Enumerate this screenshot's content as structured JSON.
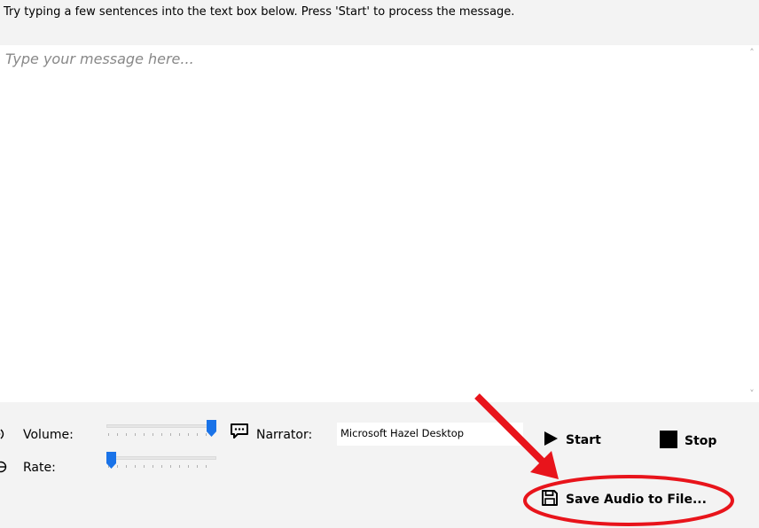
{
  "instruction": "Try typing a few sentences into the text box below. Press 'Start' to process the message.",
  "message_box": {
    "placeholder": "Type your message here...",
    "value": ""
  },
  "controls": {
    "volume_label": "Volume:",
    "volume_level": 1.0,
    "rate_label": "Rate:",
    "rate_level": 0.0,
    "narrator_label": "Narrator:",
    "narrator_value": "Microsoft Hazel Desktop"
  },
  "buttons": {
    "start_label": "Start",
    "stop_label": "Stop",
    "save_label": "Save Audio to File..."
  },
  "icons": {
    "volume": "speaker-icon",
    "rate": "speedometer-icon",
    "narrator": "speech-bubble-icon",
    "start": "play-icon",
    "stop": "stop-square-icon",
    "save": "floppy-disk-icon"
  },
  "colors": {
    "accent": "#1a73e8",
    "annotation": "#e8141b"
  }
}
